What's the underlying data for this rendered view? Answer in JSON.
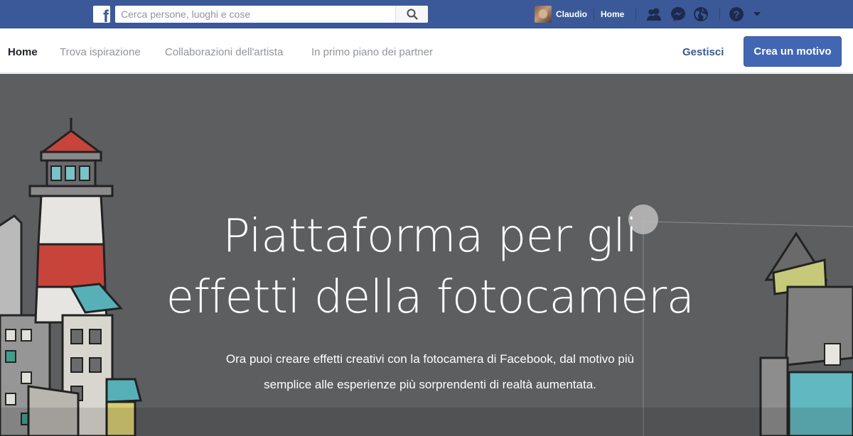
{
  "topbar": {
    "logo_letter": "f",
    "search_placeholder": "Cerca persone, luoghi e cose",
    "search_icon": "search-icon",
    "user_name": "Claudio",
    "home_label": "Home",
    "icons": [
      "friends-icon",
      "messenger-icon",
      "globe-icon",
      "help-icon",
      "caret-down-icon"
    ]
  },
  "subnav": {
    "tabs": [
      {
        "label": "Home",
        "active": true
      },
      {
        "label": "Trova ispirazione",
        "active": false
      },
      {
        "label": "Collaborazioni dell'artista",
        "active": false
      },
      {
        "label": "In primo piano dei partner",
        "active": false
      }
    ],
    "manage_label": "Gestisci",
    "create_label": "Crea un motivo"
  },
  "hero": {
    "title_line1": "Piattaforma per gli",
    "title_line2": "effetti della fotocamera",
    "subtitle_line1": "Ora puoi creare effetti creativi con la fotocamera di Facebook, dal motivo più",
    "subtitle_line2": "semplice alle esperienze più sorprendenti di realtà aumentata."
  },
  "colors": {
    "brand_blue": "#3b5998",
    "button_blue": "#4267b2",
    "link_blue": "#365899",
    "hero_bg": "#5d5e60"
  }
}
